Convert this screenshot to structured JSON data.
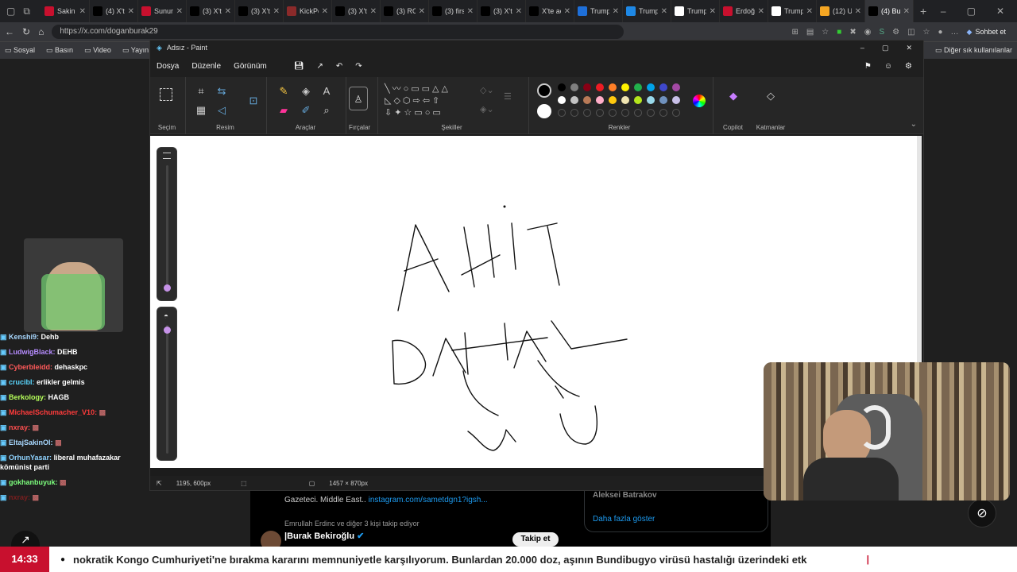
{
  "browser": {
    "tabs": [
      {
        "label": "Sakin",
        "icon": "x-logo-icon",
        "color": "#c8102e",
        "active": false
      },
      {
        "label": "(4) X'te",
        "icon": "x-logo-icon",
        "color": "#000000",
        "active": false
      },
      {
        "label": "Sunum",
        "icon": "x-logo-icon",
        "color": "#c8102e",
        "active": false
      },
      {
        "label": "(3) X'te",
        "icon": "x-logo-icon",
        "color": "#000000",
        "active": false
      },
      {
        "label": "(3) X'te",
        "icon": "x-logo-icon",
        "color": "#000000",
        "active": false
      },
      {
        "label": "KickPe",
        "icon": "kick-icon",
        "color": "#8b2a2a",
        "active": false
      },
      {
        "label": "(3) X'te",
        "icon": "x-logo-icon",
        "color": "#000000",
        "active": false
      },
      {
        "label": "(3) RO",
        "icon": "x-logo-icon",
        "color": "#000000",
        "active": false
      },
      {
        "label": "(3) firs",
        "icon": "x-logo-icon",
        "color": "#000000",
        "active": false
      },
      {
        "label": "(3) X'te",
        "icon": "x-logo-icon",
        "color": "#000000",
        "active": false
      },
      {
        "label": "X'te aç",
        "icon": "x-logo-icon",
        "color": "#000000",
        "active": false
      },
      {
        "label": "Trump",
        "icon": "news-icon",
        "color": "#1e6fd9",
        "active": false
      },
      {
        "label": "Trump",
        "icon": "circle-icon",
        "color": "#1e88e5",
        "active": false
      },
      {
        "label": "Trump",
        "icon": "nyt-icon",
        "color": "#ffffff",
        "active": false
      },
      {
        "label": "Erdoğ",
        "icon": "b-icon",
        "color": "#c8102e",
        "active": false
      },
      {
        "label": "Trump",
        "icon": "n-icon",
        "color": "#ffffff",
        "active": false
      },
      {
        "label": "(12) U",
        "icon": "orange-icon",
        "color": "#f5a623",
        "active": false
      },
      {
        "label": "(4) Bu",
        "icon": "x-logo-icon",
        "color": "#000000",
        "active": true
      }
    ],
    "url": "https://x.com/doganburak29",
    "chat_button": "Sohbet et",
    "bookmarks": [
      "Sosyal",
      "Basın",
      "Video",
      "Yayın"
    ],
    "other_bookmarks": "Diğer sık kullanılanlar"
  },
  "paint": {
    "title": "Adsız - Paint",
    "menu": [
      "Dosya",
      "Düzenle",
      "Görünüm"
    ],
    "groups": {
      "selection": "Seçim",
      "image": "Resim",
      "tools": "Araçlar",
      "brushes": "Fırçalar",
      "shapes": "Şekiller",
      "colors": "Renkler",
      "copilot": "Copilot",
      "layers": "Katmanlar"
    },
    "palette_row1": [
      "#000000",
      "#7f7f7f",
      "#880015",
      "#ed1c24",
      "#ff7f27",
      "#fff200",
      "#22b14c",
      "#00a2e8",
      "#3f48cc",
      "#a349a4"
    ],
    "palette_row2": [
      "#ffffff",
      "#c3c3c3",
      "#b97a57",
      "#ffaec9",
      "#ffc90e",
      "#efe4b0",
      "#b5e61d",
      "#99d9ea",
      "#7092be",
      "#c8bfe7"
    ],
    "cursor_position": "1195, 600px",
    "canvas_size": "1457 × 870px",
    "handwriting": {
      "word1": "AHIT",
      "word2": "DAHAL",
      "annotations": [
        "U",
        "U"
      ]
    }
  },
  "chat": [
    {
      "user": "Kenshi9:",
      "msg": "Dehb",
      "color": "#a8d8ff"
    },
    {
      "user": "LudwigBlack:",
      "msg": "DEHB",
      "color": "#b68cff"
    },
    {
      "user": "Cyberbleidd:",
      "msg": "dehaskpc",
      "color": "#ff5a5a"
    },
    {
      "user": "crucibl:",
      "msg": "erlikler gelmis",
      "color": "#5ad8ff"
    },
    {
      "user": "Berkology:",
      "msg": "HAGB",
      "color": "#b6ff5a"
    },
    {
      "user": "MichaelSchumacher_V10:",
      "msg": "",
      "color": "#ff3b3b"
    },
    {
      "user": "nxray:",
      "msg": "",
      "color": "#ff4f4f"
    },
    {
      "user": "EltajSakinOl:",
      "msg": "",
      "color": "#a8d8ff"
    },
    {
      "user": "OrhunYasar:",
      "msg": "liberal muhafazakar kömünist parti",
      "color": "#8fd3ff"
    },
    {
      "user": "gokhanbuyuk:",
      "msg": "",
      "color": "#7dff7d"
    },
    {
      "user": "nxray:",
      "msg": "",
      "color": "#7a1f1f"
    }
  ],
  "twitter": {
    "bio": "Gazeteci. Middle East..",
    "bio_link": "instagram.com/sametdgn1?igsh...",
    "followed_by": "Emrullah Erdinc ve diğer 3 kişi takip ediyor",
    "suggested_name": "Burak Bekiroğlu",
    "follow_button": "Takip et",
    "right_name": "Aleksei Batrakov",
    "show_more": "Daha fazla göster"
  },
  "ticker": {
    "time": "14:33",
    "text": "nokratik Kongo Cumhuriyeti'ne bırakma kararını memnuniyetle karşılıyorum. Bunlardan 20.000 doz, aşının Bundibugyo virüsü hastalığı üzerindeki etk"
  }
}
